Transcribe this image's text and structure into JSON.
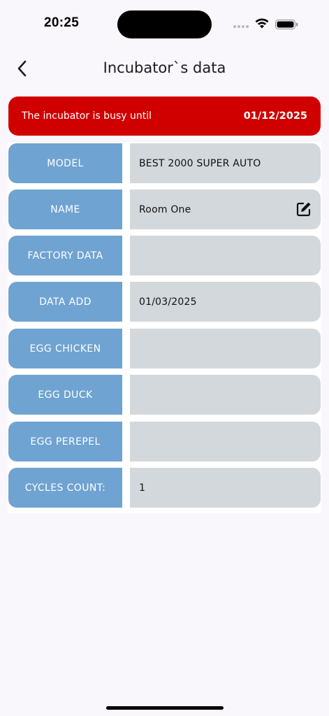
{
  "status_bar": {
    "time": "20:25",
    "icons": [
      "cellular-signal-icon",
      "wifi-icon",
      "battery-icon"
    ]
  },
  "header": {
    "title": "Incubator`s data",
    "back_icon": "chevron-left-icon"
  },
  "banner": {
    "text": "The incubator is busy until",
    "date": "01/12/2025",
    "color": "#d10000"
  },
  "colors": {
    "label_bg": "#6fa3d1",
    "value_bg": "#d2d8dc",
    "background": "#f9f6fc"
  },
  "rows": [
    {
      "label": "MODEL",
      "value": "BEST 2000 SUPER AUTO"
    },
    {
      "label": "NAME",
      "value": "Room One",
      "edit_icon": "edit-icon"
    },
    {
      "label": "FACTORY DATA",
      "value": ""
    },
    {
      "label": "DATA ADD",
      "value": "01/03/2025"
    },
    {
      "label": "EGG CHICKEN",
      "value": ""
    },
    {
      "label": "EGG DUCK",
      "value": ""
    },
    {
      "label": "EGG PEREPEL",
      "value": ""
    },
    {
      "label": "CYCLES COUNT:",
      "value": "1"
    }
  ]
}
